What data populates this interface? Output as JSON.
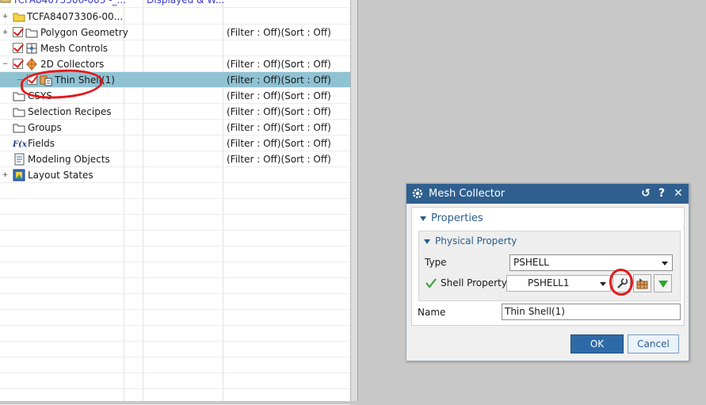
{
  "tree": {
    "top_row": {
      "name": "TCFA84073306-003 -_...",
      "displayed": "Displayed & W..."
    },
    "rows": [
      {
        "name": "TCFA84073306-00...",
        "filter": ""
      },
      {
        "name": "Polygon Geometry",
        "filter": "(Filter : Off)(Sort : Off)"
      },
      {
        "name": "Mesh Controls",
        "filter": ""
      },
      {
        "name": "2D Collectors",
        "filter": "(Filter : Off)(Sort : Off)"
      },
      {
        "name": "Thin Shell(1)",
        "filter": "(Filter : Off)(Sort : Off)"
      },
      {
        "name": "CSYS",
        "filter": "(Filter : Off)(Sort : Off)"
      },
      {
        "name": "Selection Recipes",
        "filter": "(Filter : Off)(Sort : Off)"
      },
      {
        "name": "Groups",
        "filter": "(Filter : Off)(Sort : Off)"
      },
      {
        "name": "Fields",
        "filter": "(Filter : Off)(Sort : Off)"
      },
      {
        "name": "Modeling Objects",
        "filter": "(Filter : Off)(Sort : Off)"
      },
      {
        "name": "Layout States",
        "filter": ""
      }
    ],
    "expanders": {
      "collapsed": "+",
      "expanded": "−"
    },
    "selected_color": "#8fc2d3"
  },
  "dialog": {
    "title": "Mesh Collector",
    "titlebar_buttons": {
      "reset": "↺",
      "help": "?",
      "close": "✕"
    },
    "properties_label": "Properties",
    "physical_property_label": "Physical Property",
    "type_label": "Type",
    "type_value": "PSHELL",
    "shell_property_label": "Shell Property",
    "shell_property_value": "PSHELL1",
    "name_label": "Name",
    "name_value": "Thin Shell(1)",
    "ok_label": "OK",
    "cancel_label": "Cancel",
    "titlebar_color": "#2f5f8f",
    "accent_color": "#2a5d8e"
  },
  "icons": [
    "gear-icon",
    "folder-icon",
    "mesh-controls-icon",
    "collector-icon",
    "shell-mesh-icon",
    "fields-icon",
    "modeling-objects-icon",
    "layout-states-icon",
    "wrench-icon",
    "mesh-edit-icon",
    "green-checkmark-icon",
    "dropdown-arrow-icon"
  ]
}
